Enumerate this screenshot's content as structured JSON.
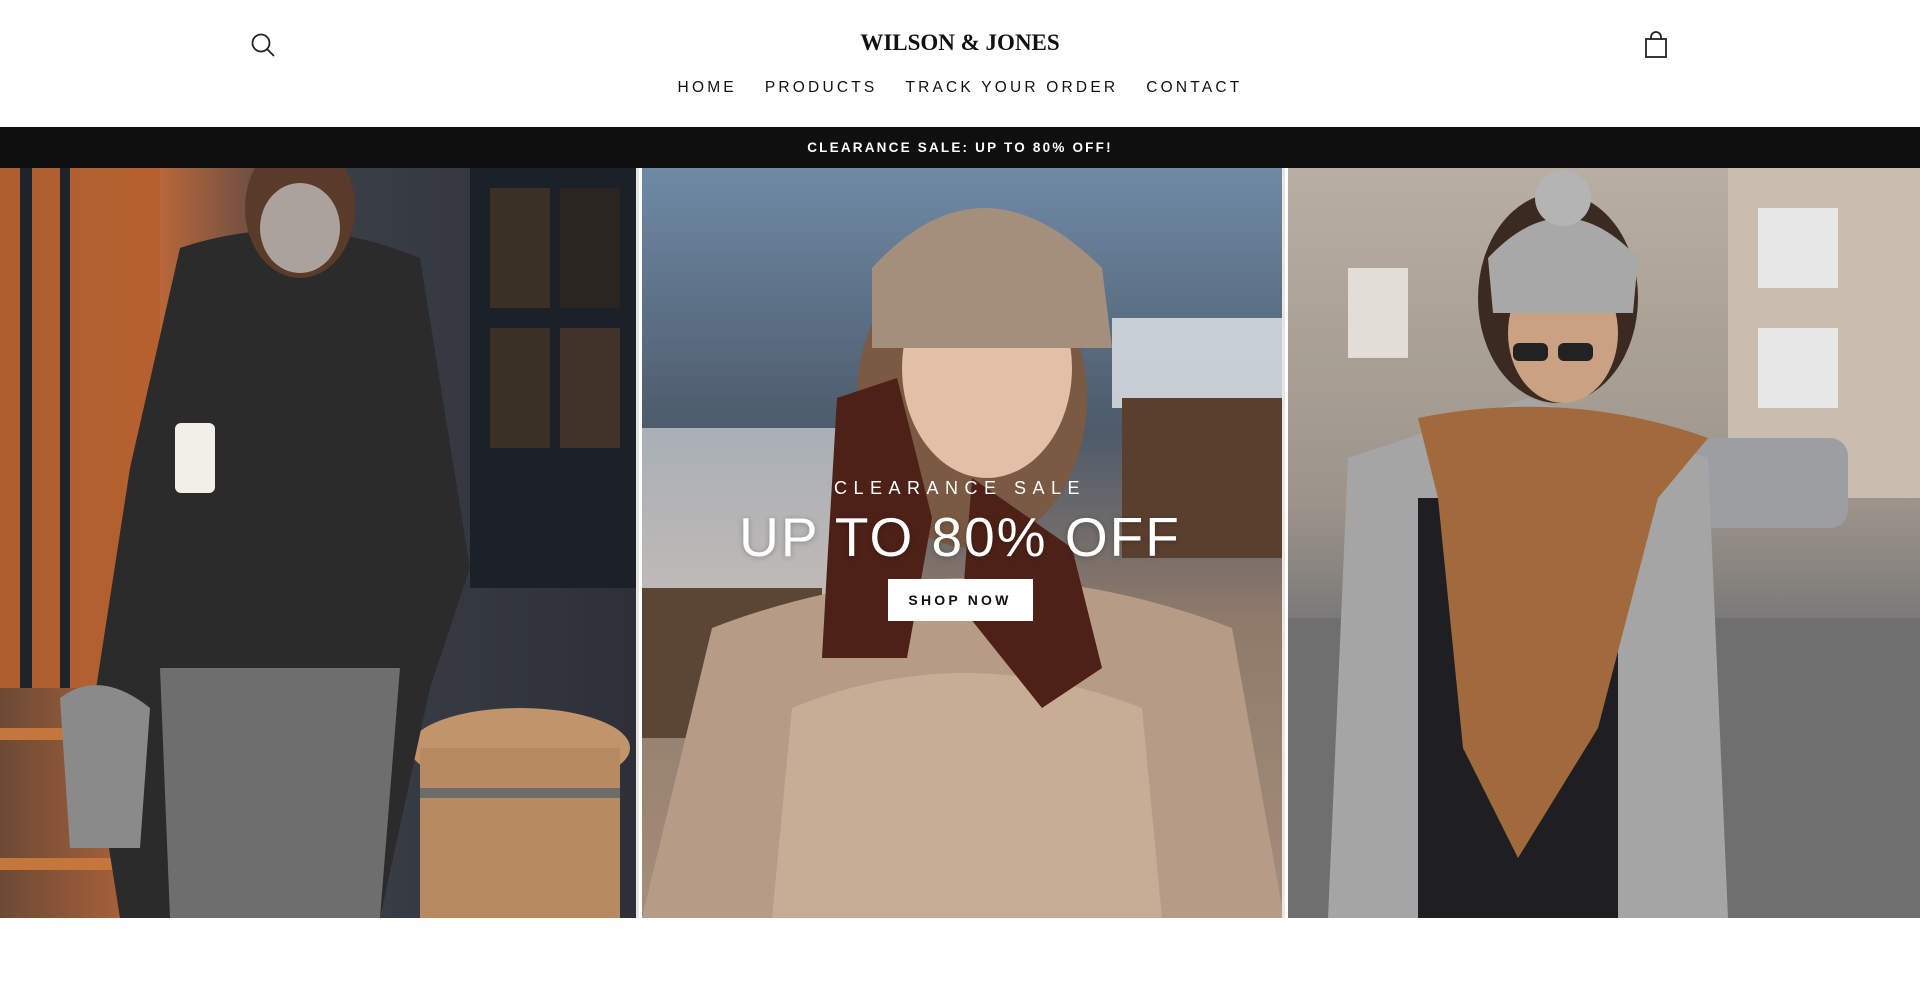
{
  "header": {
    "logo": "WILSON & JONES",
    "nav": [
      "HOME",
      "PRODUCTS",
      "TRACK YOUR ORDER",
      "CONTACT"
    ],
    "search_icon": "search-icon",
    "cart_icon": "shopping-bag-icon"
  },
  "announcement": "CLEARANCE SALE: UP TO 80% OFF!",
  "hero": {
    "subtitle": "CLEARANCE SALE",
    "title": "UP TO 80% OFF",
    "button": "SHOP NOW"
  },
  "colors": {
    "announcement_bg": "#0f0f0f",
    "text": "#111111",
    "button_bg": "#ffffff"
  }
}
